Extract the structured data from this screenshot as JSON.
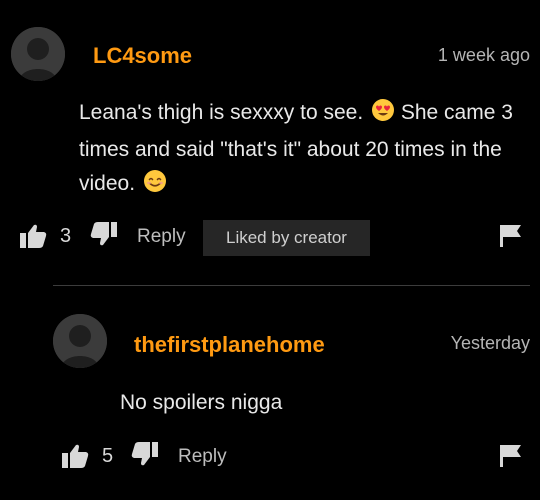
{
  "comments": [
    {
      "username": "LC4some",
      "timestamp": "1 week ago",
      "text": "Leana's thigh is sexxxy to see.",
      "text_2": "She came 3 times and said \"that's it\" about 20 times in the video.",
      "emojis": [
        "heart-eyes-emoji",
        "smiling-emoji"
      ],
      "likes": "3",
      "reply_label": "Reply",
      "badge": "Liked by creator",
      "icons": [
        "thumbs-up-icon",
        "thumbs-down-icon",
        "flag-icon"
      ]
    }
  ],
  "replies": [
    {
      "username": "thefirstplanehome",
      "timestamp": "Yesterday",
      "text": "No spoilers nigga",
      "likes": "5",
      "reply_label": "Reply",
      "icons": [
        "thumbs-up-icon",
        "thumbs-down-icon",
        "flag-icon"
      ]
    }
  ],
  "colors": {
    "background": "#000000",
    "username": "#ff9a12",
    "text": "#e9e9e9",
    "badge_bg": "#262626"
  }
}
